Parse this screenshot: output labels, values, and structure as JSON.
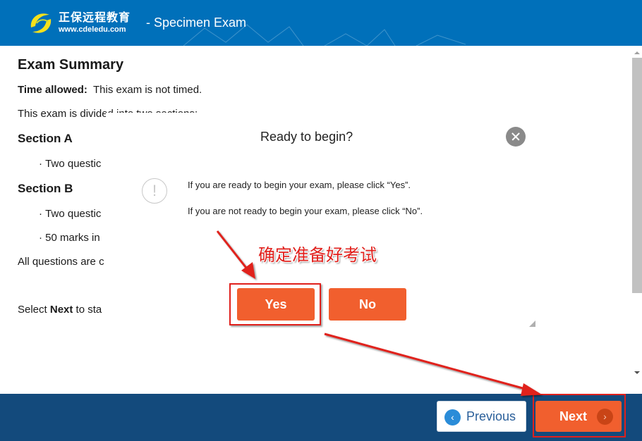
{
  "header": {
    "logo_cn": "正保远程教育",
    "logo_url": "www.cdeledu.com",
    "exam_title": "- Specimen Exam"
  },
  "summary": {
    "title": "Exam Summary",
    "time_label": "Time allowed:",
    "time_value": "This exam is not timed.",
    "divided": "This exam is divided into two sections:",
    "section_a": "Section A",
    "section_a_items": [
      "Two questic"
    ],
    "section_b": "Section B",
    "section_b_items": [
      "Two questic",
      "50 marks in"
    ],
    "all_questions": "All questions are c",
    "select_prefix": "Select ",
    "select_bold": "Next",
    "select_suffix": " to sta"
  },
  "dialog": {
    "title": "Ready to begin?",
    "close_icon": "close-icon",
    "warning_icon": "!",
    "message_yes": "If you are ready to begin your exam, please click “Yes”.",
    "message_no": "If you are not ready to begin your exam, please click “No”.",
    "yes_label": "Yes",
    "no_label": "No"
  },
  "annotation": {
    "text": "确定准备好考试",
    "color": "#e0201c"
  },
  "footer": {
    "previous_label": "Previous",
    "previous_icon": "‹",
    "next_label": "Next",
    "next_icon": "›"
  },
  "colors": {
    "header_bg": "#0070ba",
    "footer_bg": "#134a7c",
    "accent_orange": "#f15f2e",
    "annotation_red": "#e0201c"
  }
}
